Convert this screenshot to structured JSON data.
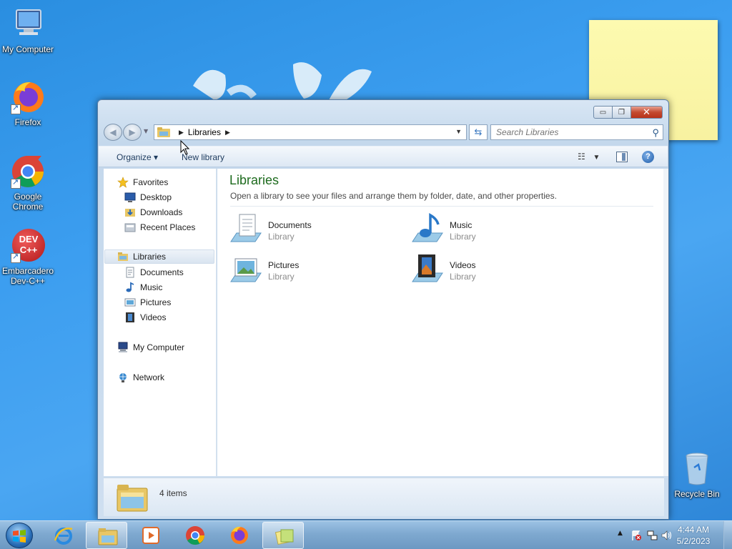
{
  "desktop": {
    "icons": [
      {
        "label_line1": "My Computer",
        "label_line2": ""
      },
      {
        "label_line1": "Firefox",
        "label_line2": ""
      },
      {
        "label_line1": "Google",
        "label_line2": "Chrome"
      },
      {
        "label_line1": "Embarcadero",
        "label_line2": "Dev-C++"
      },
      {
        "label_line1": "Recycle Bin",
        "label_line2": ""
      }
    ],
    "devcpp_logo_text": "DEV\nC++"
  },
  "window": {
    "address": {
      "segment": "Libraries"
    },
    "search": {
      "placeholder": "Search Libraries"
    },
    "toolbar": {
      "organize_label": "Organize ▾",
      "new_library_label": "New library",
      "help_glyph": "?"
    },
    "caption": {
      "minimize_glyph": "▭",
      "maximize_glyph": "❐",
      "close_glyph": "✕"
    },
    "nav": {
      "favorites": "Favorites",
      "desktop": "Desktop",
      "downloads": "Downloads",
      "recent_places": "Recent Places",
      "libraries": "Libraries",
      "documents": "Documents",
      "music": "Music",
      "pictures": "Pictures",
      "videos": "Videos",
      "my_computer": "My Computer",
      "network": "Network"
    },
    "content": {
      "title": "Libraries",
      "subtitle": "Open a library to see your files and arrange them by folder, date, and other properties.",
      "libraries": [
        {
          "name": "Documents",
          "type": "Library"
        },
        {
          "name": "Music",
          "type": "Library"
        },
        {
          "name": "Pictures",
          "type": "Library"
        },
        {
          "name": "Videos",
          "type": "Library"
        }
      ]
    },
    "status": {
      "items_text": "4 items"
    }
  },
  "taskbar": {
    "clock_time": "4:44 AM",
    "clock_date": "5/2/2023",
    "tray_up_glyph": "▲"
  },
  "colors": {
    "title_green": "#1e6b1e",
    "accent_blue": "#1e5ca8"
  }
}
